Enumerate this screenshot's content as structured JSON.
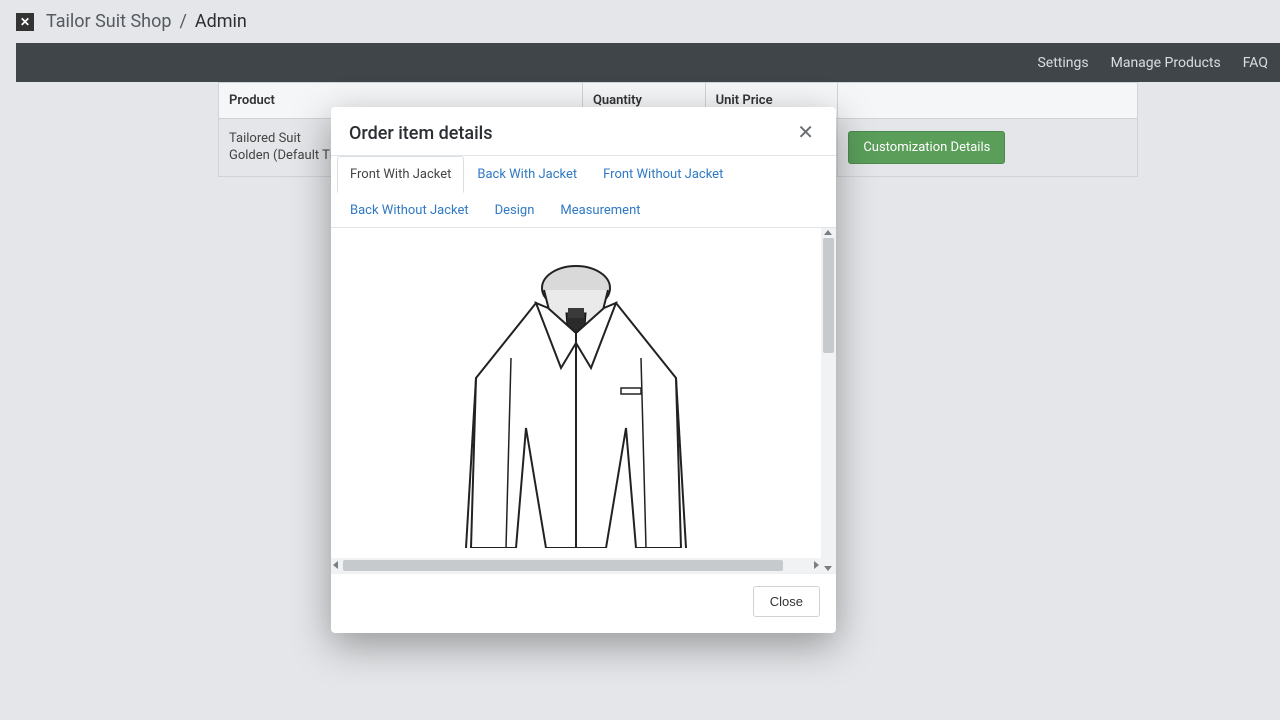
{
  "breadcrumb": {
    "shop": "Tailor Suit Shop",
    "sep": "/",
    "admin": "Admin"
  },
  "nav": {
    "settings": "Settings",
    "manage_products": "Manage Products",
    "faq": "FAQ"
  },
  "table": {
    "headers": {
      "product": "Product",
      "quantity": "Quantity",
      "unit_price": "Unit Price",
      "action": ""
    },
    "rows": [
      {
        "name": "Tailored Suit",
        "variant": "Golden (Default Title)",
        "quantity": "",
        "unit_price": "",
        "action_label": "Customization Details"
      }
    ]
  },
  "modal": {
    "title": "Order item details",
    "tabs": [
      {
        "label": "Front With Jacket",
        "active": true
      },
      {
        "label": "Back With Jacket",
        "active": false
      },
      {
        "label": "Front Without Jacket",
        "active": false
      },
      {
        "label": "Back Without Jacket",
        "active": false
      },
      {
        "label": "Design",
        "active": false
      },
      {
        "label": "Measurement",
        "active": false
      }
    ],
    "close_label": "Close"
  }
}
